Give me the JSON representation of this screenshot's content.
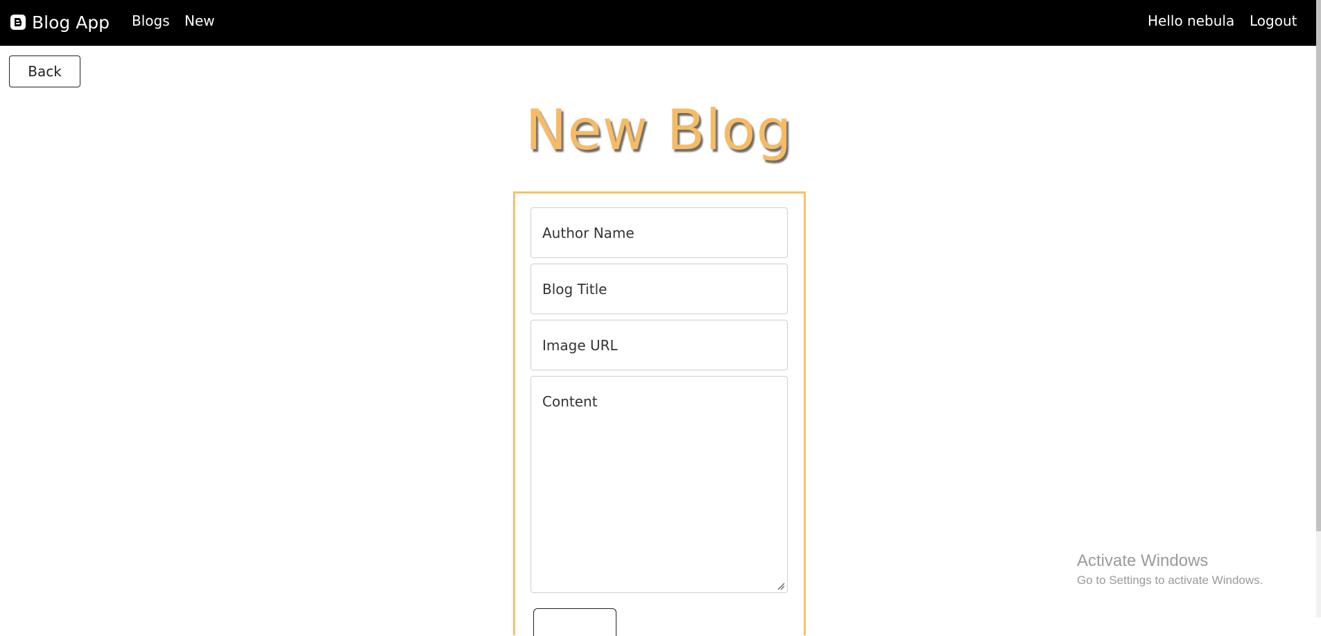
{
  "navbar": {
    "brand_icon": "blogger-icon",
    "brand_text": "Blog App",
    "links": [
      {
        "label": "Blogs"
      },
      {
        "label": "New"
      }
    ],
    "greeting": "Hello nebula",
    "logout_label": "Logout"
  },
  "back_label": "Back",
  "page_title": "New Blog",
  "form": {
    "author_placeholder": "Author Name",
    "title_placeholder": "Blog Title",
    "image_placeholder": "Image URL",
    "content_placeholder": "Content"
  },
  "watermark": {
    "title": "Activate Windows",
    "subtitle": "Go to Settings to activate Windows."
  },
  "colors": {
    "navbar_bg": "#000000",
    "accent": "#f7bb63",
    "card_border": "#fbbf6b"
  }
}
